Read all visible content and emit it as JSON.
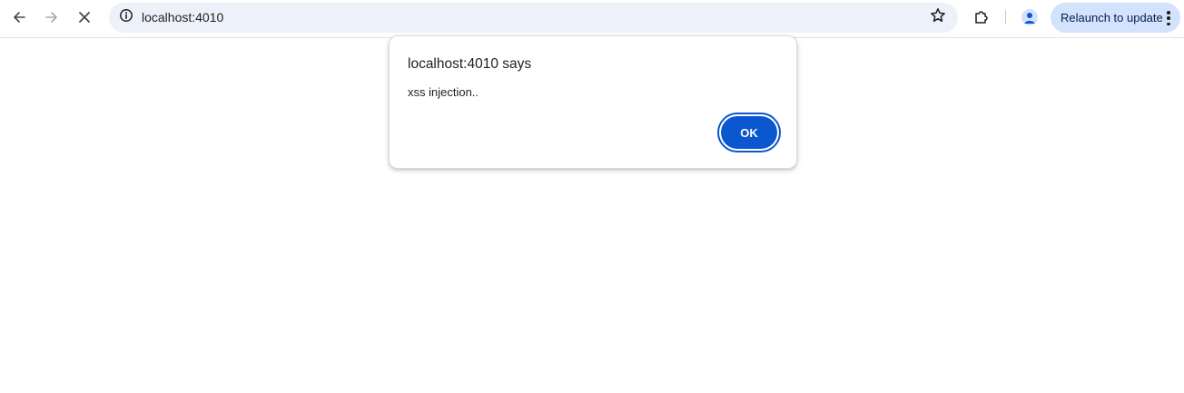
{
  "browser": {
    "url": "localhost:4010",
    "relaunch_label": "Relaunch to update",
    "icons": {
      "back": "arrow-left-icon",
      "forward": "arrow-right-icon",
      "stop": "close-icon",
      "site_info": "info-icon",
      "bookmark": "star-icon",
      "extensions": "puzzle-icon",
      "profile": "person-icon",
      "menu": "kebab-menu-icon"
    },
    "colors": {
      "omnibox_bg": "#edf1f9",
      "relaunch_bg": "#d3e3fd",
      "accent": "#0b57d0"
    }
  },
  "dialog": {
    "title": "localhost:4010 says",
    "message": "xss injection..",
    "ok_label": "OK"
  }
}
